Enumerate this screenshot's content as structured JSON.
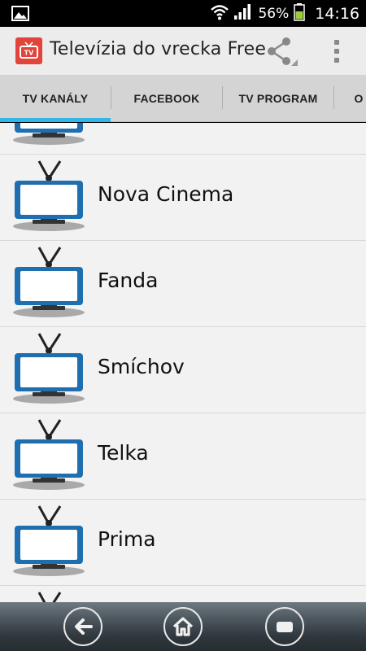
{
  "status_bar": {
    "battery_percent": "56%",
    "time": "14:16",
    "icons": [
      "image-icon",
      "wifi-icon",
      "signal-icon",
      "battery-icon"
    ]
  },
  "action_bar": {
    "app_title": "Televízia do vrecka Free",
    "app_icon": "tv-app-icon",
    "share_icon": "share-icon",
    "menu_icon": "overflow-menu-icon",
    "accent_color": "#e2433b"
  },
  "tabs": [
    {
      "label": "TV KANÁLY",
      "selected": true
    },
    {
      "label": "FACEBOOK",
      "selected": false
    },
    {
      "label": "TV PROGRAM",
      "selected": false
    },
    {
      "label": "O",
      "selected": false
    }
  ],
  "tab_indicator_color": "#33b5e5",
  "channels": [
    {
      "name": ""
    },
    {
      "name": "Nova Cinema"
    },
    {
      "name": "Fanda"
    },
    {
      "name": "Smíchov"
    },
    {
      "name": "Telka"
    },
    {
      "name": "Prima"
    },
    {
      "name": ""
    }
  ],
  "nav_bar": {
    "buttons": [
      "back-icon",
      "home-icon",
      "recent-apps-icon"
    ]
  }
}
